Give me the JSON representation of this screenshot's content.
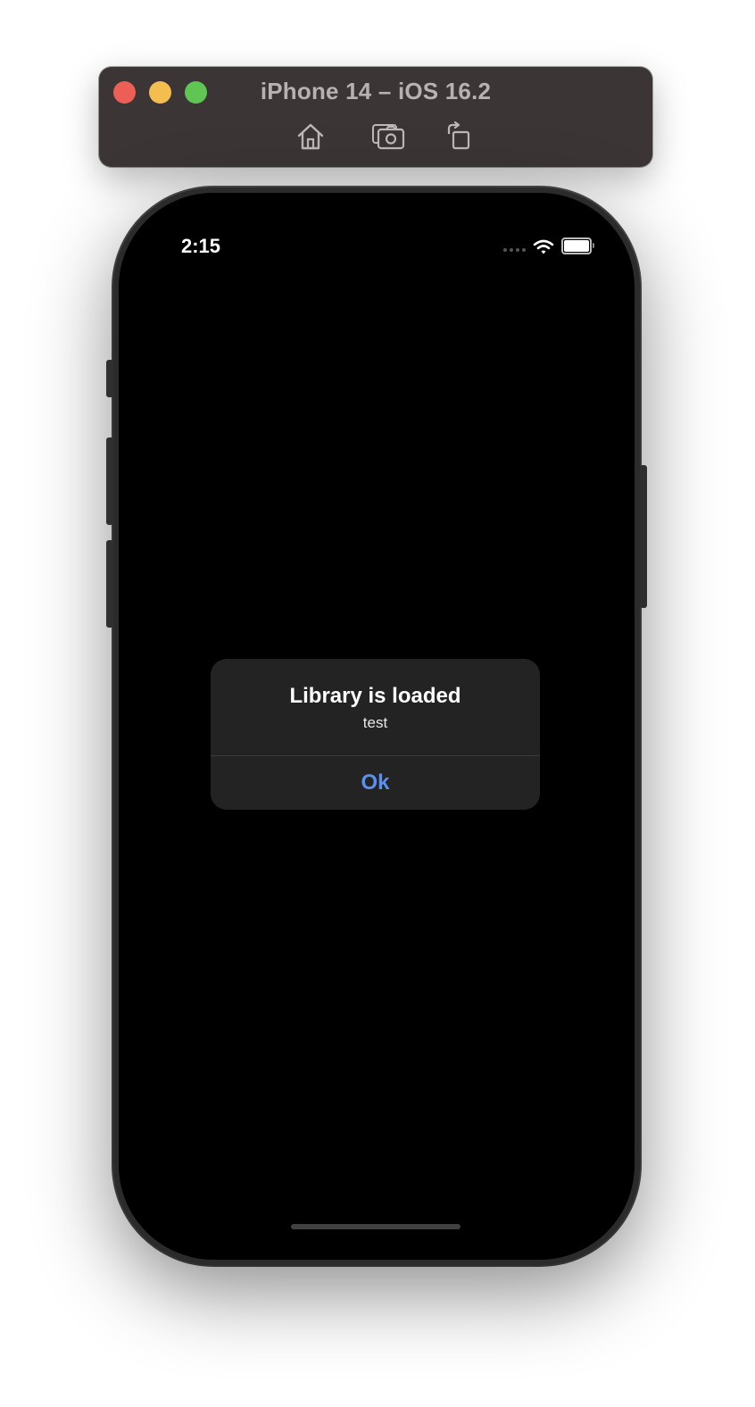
{
  "window": {
    "title": "iPhone 14 – iOS 16.2",
    "toolbar": {
      "icons": [
        "home-icon",
        "screenshot-icon",
        "rotate-icon"
      ]
    }
  },
  "status_bar": {
    "time": "2:15",
    "icons": [
      "cellular-signal-icon",
      "wifi-icon",
      "battery-icon"
    ]
  },
  "alert": {
    "title": "Library is loaded",
    "message": "test",
    "button_label": "Ok",
    "button_color": "#5b8ff0"
  }
}
